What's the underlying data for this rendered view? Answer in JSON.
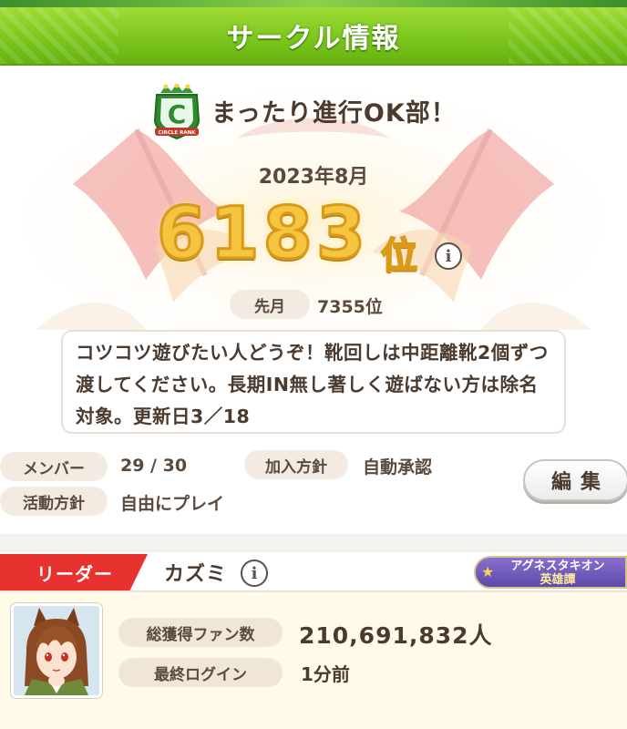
{
  "header": {
    "title": "サークル情報"
  },
  "circle": {
    "name": "まったり進行OK部！",
    "rank_letter": "C",
    "rank_badge_text": "CIRCLE RANK",
    "rank_date": "2023年8月",
    "rank_value": "6183",
    "rank_suffix": "位",
    "last_month_label": "先月",
    "last_month_value": "7355位",
    "comment": "コツコツ遊びたい人どうぞ！靴回しは中距離靴2個ずつ渡してください。長期IN無し著しく遊ばない方は除名対象。更新日3／18"
  },
  "info": {
    "members_label": "メンバー",
    "members_value": "29 / 30",
    "join_policy_label": "加入方針",
    "join_policy_value": "自動承認",
    "activity_label": "活動方針",
    "activity_value": "自由にプレイ",
    "edit_button": "編集"
  },
  "leader": {
    "tag": "リーダー",
    "name": "カズミ",
    "title_line1": "アグネスタキオン",
    "title_line2": "英雄譚",
    "fans_label": "総獲得ファン数",
    "fans_value": "210,691,832人",
    "last_login_label": "最終ログイン",
    "last_login_value": "1分前"
  },
  "icons": {
    "info": "info-icon",
    "rank_badge": "circle-rank-badge-icon",
    "avatar": "trainer-avatar"
  },
  "colors": {
    "header_green": "#7cc61e",
    "leader_red": "#e8322f",
    "rank_gold": "#f5c542",
    "title_purple": "#5b4aa8"
  }
}
